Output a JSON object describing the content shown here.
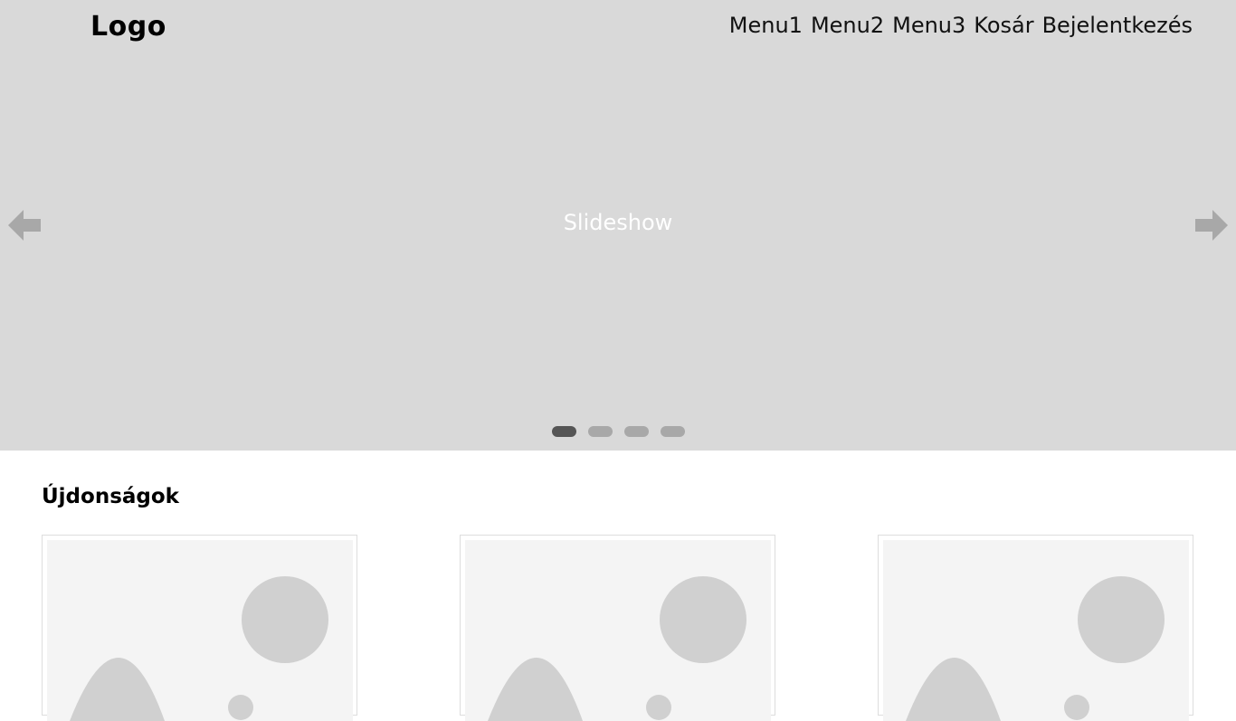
{
  "header": {
    "logo": "Logo",
    "menu": [
      "Menu1",
      "Menu2",
      "Menu3",
      "Kosár",
      "Bejelentkezés"
    ]
  },
  "slideshow": {
    "label": "Slideshow",
    "dots": 4,
    "active_index": 0
  },
  "section": {
    "title": "Újdonságok"
  },
  "products": [
    {
      "image": "image-placeholder"
    },
    {
      "image": "image-placeholder"
    },
    {
      "image": "image-placeholder"
    }
  ],
  "colors": {
    "hero_bg": "#d9d9d9",
    "arrow": "#a8a8a8",
    "dot_active": "#555555",
    "dot_inactive": "#a8a8a8",
    "placeholder_bg": "#f4f4f4",
    "placeholder_shape": "#d0d0d0"
  }
}
